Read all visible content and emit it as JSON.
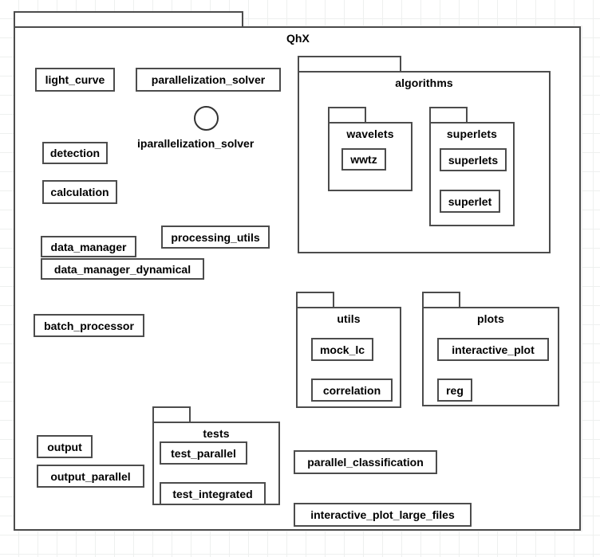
{
  "diagram": {
    "type": "uml-package-diagram",
    "root_package": "QhX",
    "background": "#ffffff",
    "grid_color": "#eef0ef",
    "line_color": "#4c4c4c",
    "shadow_color": "#f2f2f2"
  },
  "packages": {
    "qhx": {
      "label": "QhX"
    },
    "algorithms": {
      "label": "algorithms"
    },
    "wavelets": {
      "label": "wavelets"
    },
    "superlets": {
      "label": "superlets"
    },
    "utils": {
      "label": "utils"
    },
    "plots": {
      "label": "plots"
    },
    "tests": {
      "label": "tests"
    }
  },
  "modules": {
    "light_curve": "light_curve",
    "parallelization_solver": "parallelization_solver",
    "detection": "detection",
    "calculation": "calculation",
    "data_manager": "data_manager",
    "data_manager_dynamical": "data_manager_dynamical",
    "processing_utils": "processing_utils",
    "batch_processor": "batch_processor",
    "output": "output",
    "output_parallel": "output_parallel",
    "wwtz": "wwtz",
    "superlets_mod": "superlets",
    "superlet": "superlet",
    "mock_lc": "mock_lc",
    "correlation": "correlation",
    "interactive_plot": "interactive_plot",
    "reg": "reg",
    "test_parallel": "test_parallel",
    "test_integrated": "test_integrated",
    "parallel_classification": "parallel_classification",
    "interactive_plot_large_files": "interactive_plot_large_files"
  },
  "interfaces": {
    "iparallelization_solver": "iparallelization_solver"
  },
  "relations": [
    {
      "from": "detection",
      "to": "light_curve",
      "kind": "generalization"
    },
    {
      "from": "detection",
      "to": "calculation",
      "kind": "generalization"
    },
    {
      "from": "parallelization_solver",
      "to": "detection",
      "kind": "dependency"
    },
    {
      "from": "parallelization_solver",
      "to": "light_curve",
      "kind": "dependency"
    },
    {
      "from": "calculation",
      "to": "wwtz",
      "kind": "dependency"
    },
    {
      "from": "calculation",
      "to": "superlets",
      "kind": "dependency"
    },
    {
      "from": "processing_utils",
      "to": "calculation",
      "kind": "dependency"
    },
    {
      "from": "data_manager",
      "to": "light_curve",
      "kind": "dependency"
    },
    {
      "from": "batch_processor",
      "to": "mock_lc",
      "kind": "dependency"
    },
    {
      "from": "batch_processor",
      "to": "correlation",
      "kind": "dependency"
    },
    {
      "from": "test_parallel",
      "to": "output_parallel",
      "kind": "dependency"
    },
    {
      "from": "test_integrated",
      "to": "parallel_classification",
      "kind": "dependency"
    },
    {
      "from": "parallel_classification",
      "to": "reg",
      "kind": "dependency"
    },
    {
      "from": "wwtz",
      "to": "superlet",
      "kind": "generalization"
    }
  ]
}
